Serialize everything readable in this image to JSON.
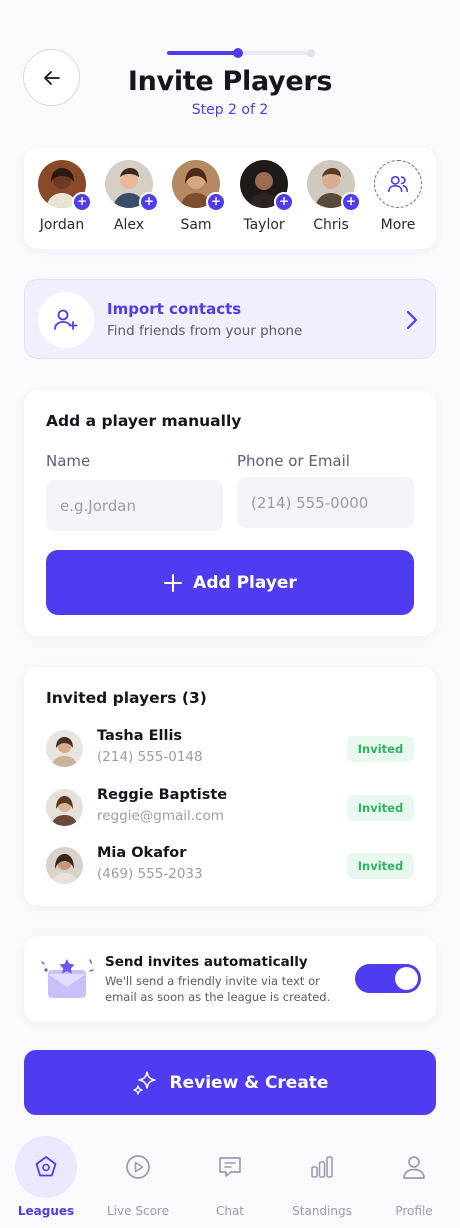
{
  "header": {
    "title": "Invite Players",
    "step": "Step 2 of 2",
    "progress": 0.48
  },
  "quick_invite": {
    "players": [
      {
        "name": "Jordan",
        "bg": "#8a4a2a",
        "skin": "#6b3a22"
      },
      {
        "name": "Alex",
        "bg": "#d6cfc6",
        "skin": "#e7b99a"
      },
      {
        "name": "Sam",
        "bg": "#b58a62",
        "skin": "#d9a680"
      },
      {
        "name": "Taylor",
        "bg": "#1e1a18",
        "skin": "#9b6a50"
      },
      {
        "name": "Chris",
        "bg": "#cfc9bf",
        "skin": "#d7ae92"
      }
    ],
    "more_label": "More"
  },
  "import": {
    "title": "Import contacts",
    "subtitle": "Find friends from your phone"
  },
  "manual": {
    "title": "Add a player manually",
    "name_label": "Name",
    "name_placeholder": "e.g.Jordan",
    "contact_label": "Phone or Email",
    "contact_placeholder": "(214) 555-0000",
    "add_label": "Add Player"
  },
  "invited": {
    "title": "Invited players (3)",
    "rows": [
      {
        "name": "Tasha Ellis",
        "contact": "(214) 555-0148",
        "status": "Invited"
      },
      {
        "name": "Reggie Baptiste",
        "contact": "reggie@gmail.com",
        "status": "Invited"
      },
      {
        "name": "Mia Okafor",
        "contact": "(469) 555-2033",
        "status": "Invited"
      }
    ]
  },
  "auto": {
    "title": "Send invites automatically",
    "description": "We'll send a friendly invite via text or email as soon as the league is created.",
    "enabled": true
  },
  "review": {
    "label": "Review & Create"
  },
  "tabs": [
    {
      "label": "Leagues",
      "icon": "pentagon-icon",
      "active": true
    },
    {
      "label": "Live Score",
      "icon": "play-circle-icon",
      "active": false
    },
    {
      "label": "Chat",
      "icon": "chat-bubble-icon",
      "active": false
    },
    {
      "label": "Standings",
      "icon": "bar-chart-icon",
      "active": false
    },
    {
      "label": "Profile",
      "icon": "user-icon",
      "active": false
    }
  ],
  "colors": {
    "accent": "#4f3cf0",
    "success": "#2fb562",
    "success_bg": "#e8f8ee"
  }
}
